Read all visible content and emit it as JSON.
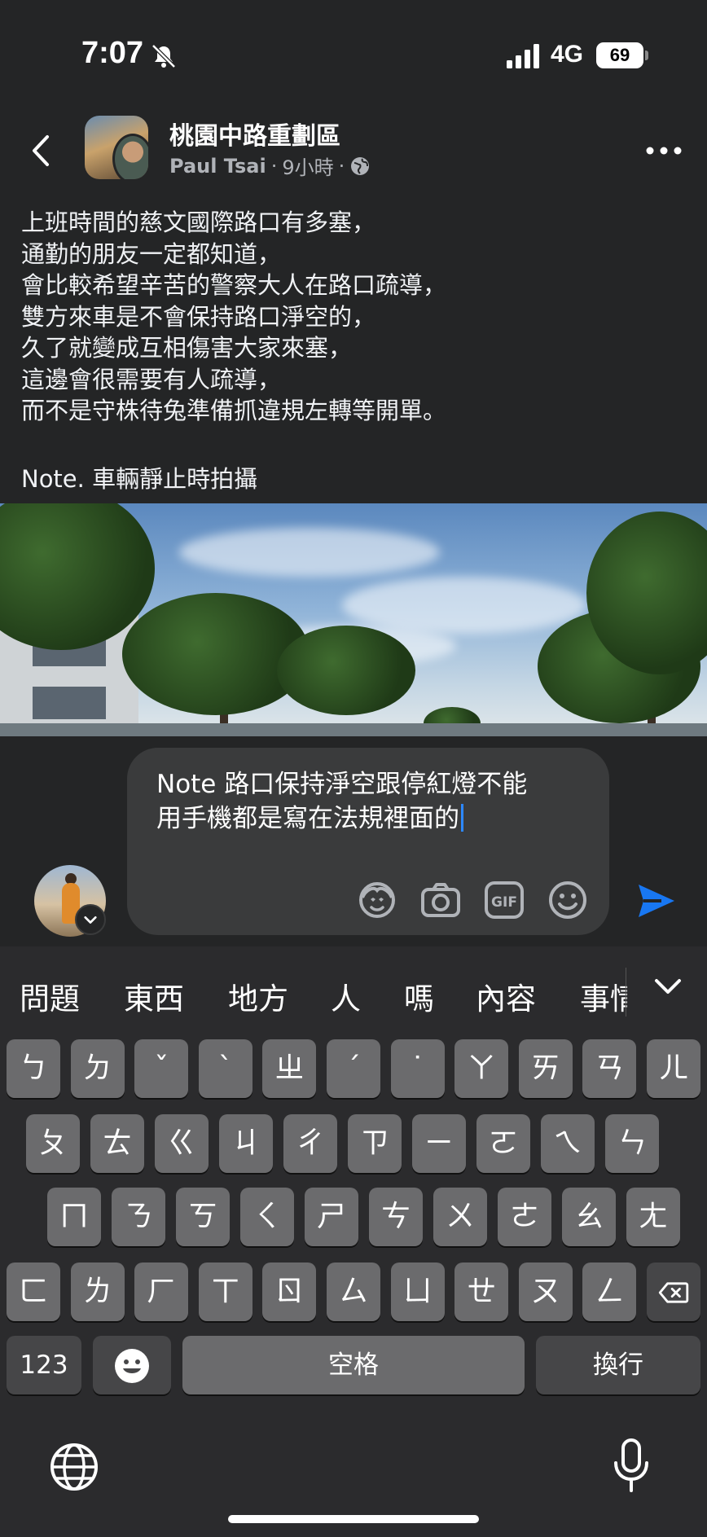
{
  "status_bar": {
    "time": "7:07",
    "network": "4G",
    "battery": "69"
  },
  "post": {
    "group_name": "桃園中路重劃區",
    "author": "Paul Tsai",
    "time_ago": "9小時",
    "separator": "·",
    "lines": [
      "上班時間的慈文國際路口有多塞，",
      "通勤的朋友一定都知道，",
      "會比較希望辛苦的警察大人在路口疏導，",
      "雙方來車是不會保持路口淨空的，",
      "久了就變成互相傷害大家來塞，",
      "這邊會很需要有人疏導，",
      "而不是守株待兔準備抓違規左轉等開單。"
    ],
    "note": "Note. 車輛靜止時拍攝"
  },
  "comment": {
    "text_line1": "Note 路口保持淨空跟停紅燈不能",
    "text_line2": "用手機都是寫在法規裡面的",
    "tools": [
      "avatar-sticker-icon",
      "camera-icon",
      "gif-icon",
      "emoji-icon"
    ],
    "send_color": "#1877f2"
  },
  "keyboard": {
    "suggestions": [
      "問題",
      "東西",
      "地方",
      "人",
      "嗎",
      "內容",
      "事情"
    ],
    "row1": [
      "ㄅ",
      "ㄉ",
      "ˇ",
      "ˋ",
      "ㄓ",
      "ˊ",
      "˙",
      "ㄚ",
      "ㄞ",
      "ㄢ",
      "ㄦ"
    ],
    "row2": [
      "ㄆ",
      "ㄊ",
      "ㄍ",
      "ㄐ",
      "ㄔ",
      "ㄗ",
      "ㄧ",
      "ㄛ",
      "ㄟ",
      "ㄣ"
    ],
    "row3": [
      "ㄇ",
      "ㄋ",
      "ㄎ",
      "ㄑ",
      "ㄕ",
      "ㄘ",
      "ㄨ",
      "ㄜ",
      "ㄠ",
      "ㄤ"
    ],
    "row4": [
      "ㄈ",
      "ㄌ",
      "ㄏ",
      "ㄒ",
      "ㄖ",
      "ㄙ",
      "ㄩ",
      "ㄝ",
      "ㄡ",
      "ㄥ"
    ],
    "numbers_key": "123",
    "space_key": "空格",
    "return_key": "換行"
  }
}
